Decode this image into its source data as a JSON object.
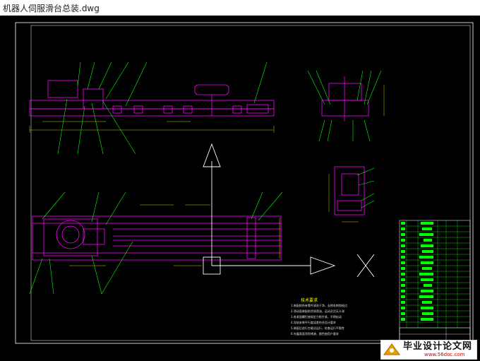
{
  "window": {
    "title": "机器人伺服滑台总装.dwg"
  },
  "notes": {
    "title": "技术要求",
    "lines": [
      "1.装配前所有零件清洗干净，去除毛刺和锐边",
      "2.滑动面装配前涂润滑油，运动灵活无卡滞",
      "3.各紧固螺钉按规定力矩拧紧，不得松动",
      "4.导轨安装平行度误差符合设计要求",
      "5.装配后进行空载试运行，检查运行平稳性",
      "6.外露表面涂防锈漆，颜色按用户要求"
    ]
  },
  "watermark": {
    "main": "毕业设计论文网",
    "sub": "www.56doc.com"
  },
  "colors": {
    "background": "#000000",
    "drawing_magenta": "#ff00ff",
    "leader_green": "#00ff00",
    "axis_white": "#ffffff",
    "frame_white": "#ffffff",
    "dimension_yellow": "#ffff00"
  }
}
